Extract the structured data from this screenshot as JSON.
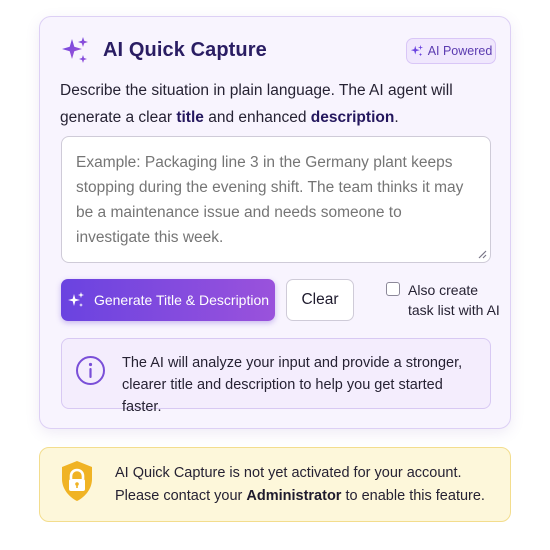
{
  "capture": {
    "title": "AI Quick Capture",
    "badge": "AI Powered",
    "desc_prefix": "Describe the situation in plain language. The AI agent will generate a clear ",
    "desc_title_word": "title",
    "desc_middle": " and enhanced ",
    "desc_description_word": "description",
    "desc_suffix": ".",
    "input_placeholder": "Example: Packaging line 3 in the Germany plant keeps stopping during the evening shift. The team thinks it may be a maintenance issue and needs someone to investigate this week.",
    "input_value": "",
    "generate_label": "Generate Title & Description",
    "clear_label": "Clear",
    "task_checkbox_label": "Also create task list with AI",
    "task_checkbox_checked": false,
    "info_text": "The AI will analyze your input and provide a stronger, clearer title and description to help you get started faster."
  },
  "notice": {
    "line1": "AI Quick Capture is not yet activated for your account.",
    "line2_prefix": "Please contact your ",
    "line2_bold": "Administrator",
    "line2_suffix": " to enable this feature."
  },
  "icons": {
    "title": "sparkles-icon",
    "badge": "sparkles-icon",
    "button": "sparkles-icon",
    "info": "info-circle-icon",
    "notice": "shield-lock-icon"
  },
  "colors": {
    "accent": "#6a43e0",
    "accent_end": "#9a52dc",
    "card_bg": "#f8f4fe",
    "warning_bg": "#fdf7da",
    "shield": "#f0b324"
  }
}
